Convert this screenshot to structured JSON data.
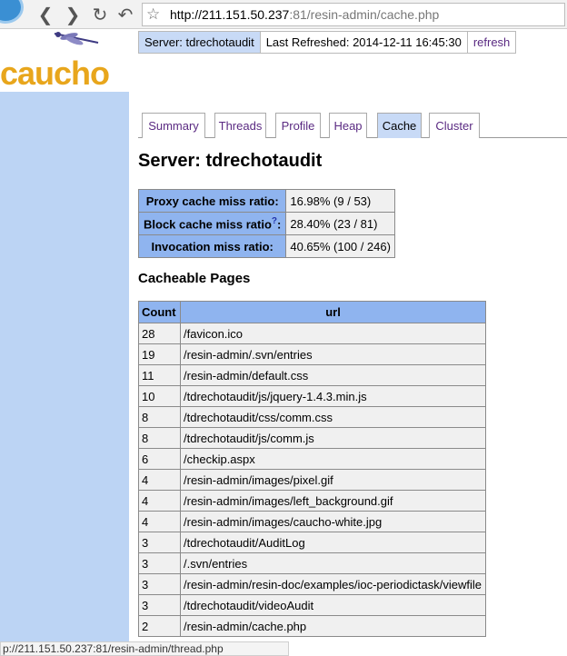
{
  "browser": {
    "url_host": "http://211.151.50.237",
    "url_rest": ":81/resin-admin/cache.php",
    "icons": [
      "back-icon",
      "forward-icon",
      "reload-icon",
      "undo-icon",
      "star-icon"
    ]
  },
  "brand": {
    "logo": "caucho",
    "color": "#e8a61c"
  },
  "infobar": {
    "server": "Server: tdrechotaudit",
    "last_refreshed": "Last Refreshed: 2014-12-11 16:45:30",
    "refresh": "refresh"
  },
  "tabs": [
    {
      "label": "Summary",
      "active": false
    },
    {
      "label": "Threads",
      "active": false
    },
    {
      "label": "Profile",
      "active": false
    },
    {
      "label": "Heap",
      "active": false
    },
    {
      "label": "Cache",
      "active": true
    },
    {
      "label": "Cluster",
      "active": false
    }
  ],
  "page_title": "Server: tdrechotaudit",
  "ratios": [
    {
      "label": "Proxy cache miss ratio:",
      "value": "16.98% (9 / 53)"
    },
    {
      "label": "Block cache miss ratio",
      "help": "?",
      "label_suffix": ":",
      "value": "28.40% (23 / 81)"
    },
    {
      "label": "Invocation miss ratio:",
      "value": "40.65% (100 / 246)"
    }
  ],
  "cacheable_title": "Cacheable Pages",
  "pages": {
    "headers": [
      "Count",
      "url"
    ],
    "rows": [
      [
        "28",
        "/favicon.ico"
      ],
      [
        "19",
        "/resin-admin/.svn/entries"
      ],
      [
        "11",
        "/resin-admin/default.css"
      ],
      [
        "10",
        "/tdrechotaudit/js/jquery-1.4.3.min.js"
      ],
      [
        "8",
        "/tdrechotaudit/css/comm.css"
      ],
      [
        "8",
        "/tdrechotaudit/js/comm.js"
      ],
      [
        "6",
        "/checkip.aspx"
      ],
      [
        "4",
        "/resin-admin/images/pixel.gif"
      ],
      [
        "4",
        "/resin-admin/images/left_background.gif"
      ],
      [
        "4",
        "/resin-admin/images/caucho-white.jpg"
      ],
      [
        "3",
        "/tdrechotaudit/AuditLog"
      ],
      [
        "3",
        "/.svn/entries"
      ],
      [
        "3",
        "/resin-admin/resin-doc/examples/ioc-periodictask/viewfile"
      ],
      [
        "3",
        "/tdrechotaudit/videoAudit"
      ],
      [
        "2",
        "/resin-admin/cache.php"
      ]
    ]
  },
  "status": "p://211.151.50.237:81/resin-admin/thread.php"
}
